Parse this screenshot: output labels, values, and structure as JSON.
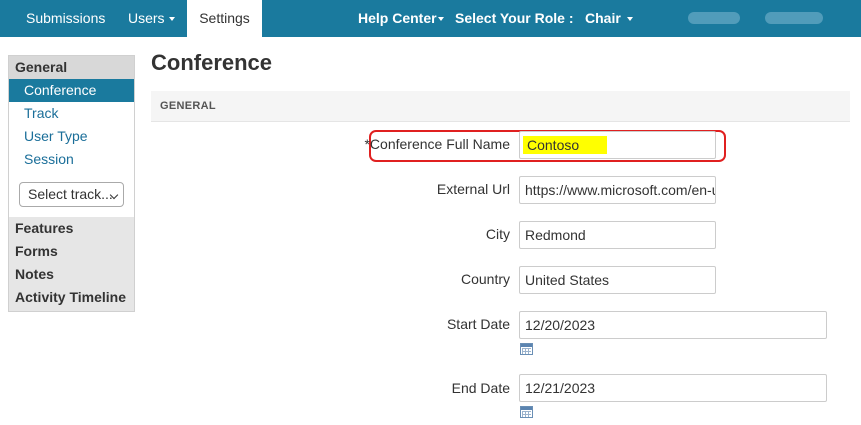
{
  "topnav": {
    "submissions": "Submissions",
    "users": "Users",
    "settings": "Settings",
    "help_center": "Help Center",
    "select_role": "Select Your Role :",
    "role": "Chair"
  },
  "sidebar": {
    "general": "General",
    "items": [
      {
        "label": "Conference"
      },
      {
        "label": "Track"
      },
      {
        "label": "User Type"
      },
      {
        "label": "Session"
      }
    ],
    "track_select": "Select track...",
    "sections": [
      {
        "label": "Features"
      },
      {
        "label": "Forms"
      },
      {
        "label": "Notes"
      },
      {
        "label": "Activity Timeline"
      }
    ]
  },
  "main": {
    "title": "Conference",
    "section": "GENERAL",
    "fields": {
      "full_name": {
        "label": "*Conference Full Name",
        "value": "Contoso"
      },
      "external_url": {
        "label": "External Url",
        "value": "https://www.microsoft.com/en-us"
      },
      "city": {
        "label": "City",
        "value": "Redmond"
      },
      "country": {
        "label": "Country",
        "value": "United States"
      },
      "start_date": {
        "label": "Start Date",
        "value": "12/20/2023"
      },
      "end_date": {
        "label": "End Date",
        "value": "12/21/2023"
      }
    }
  },
  "colors": {
    "nav": "#1a7a9e",
    "highlight": "#ffff00",
    "callout": "#e02020"
  }
}
